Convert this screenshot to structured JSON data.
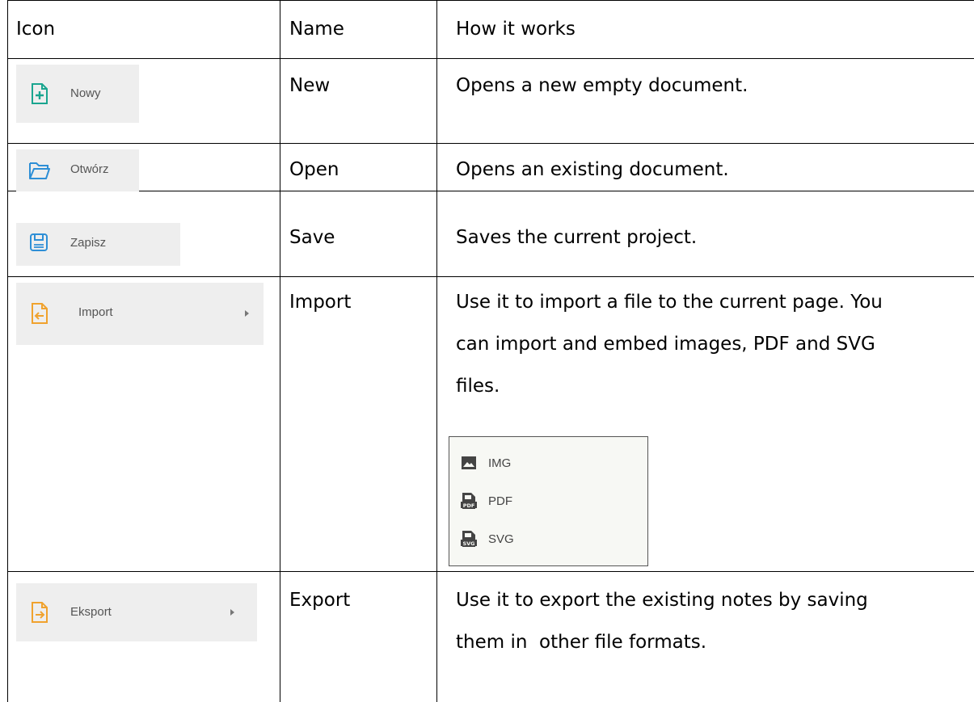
{
  "table": {
    "headers": {
      "icon": "Icon",
      "name": "Name",
      "how": "How it works"
    },
    "rows": [
      {
        "button_label": "Nowy",
        "button_icon": "new-document-icon",
        "icon_color": "#1aa58f",
        "name": "New",
        "description": [
          "Opens a new empty document."
        ]
      },
      {
        "button_label": "Otwórz",
        "button_icon": "folder-open-icon",
        "icon_color": "#2e8fd6",
        "name": "Open",
        "description": [
          "Opens an existing document."
        ]
      },
      {
        "button_label": "Zapisz",
        "button_icon": "save-icon",
        "icon_color": "#2e8fd6",
        "name": "Save",
        "description": [
          "Saves the current project."
        ]
      },
      {
        "button_label": "Import",
        "button_icon": "import-file-icon",
        "icon_color": "#f0a22e",
        "name": "Import",
        "description": [
          "Use it to import a file to the current page. You",
          "can import and embed images, PDF and SVG",
          "files."
        ]
      },
      {
        "button_label": "Eksport",
        "button_icon": "export-file-icon",
        "icon_color": "#f0a22e",
        "name": "Export",
        "description": [
          "Use it to export the existing notes by saving",
          "them in  other file formats."
        ]
      }
    ]
  },
  "import_submenu": {
    "items": [
      {
        "label": "IMG",
        "icon": "image-icon"
      },
      {
        "label": "PDF",
        "icon": "pdf-file-icon"
      },
      {
        "label": "SVG",
        "icon": "svg-file-icon"
      }
    ]
  },
  "colors": {
    "grid": "#000000",
    "button_bg": "#eeeeee",
    "submenu_bg": "#f7f8f4"
  }
}
